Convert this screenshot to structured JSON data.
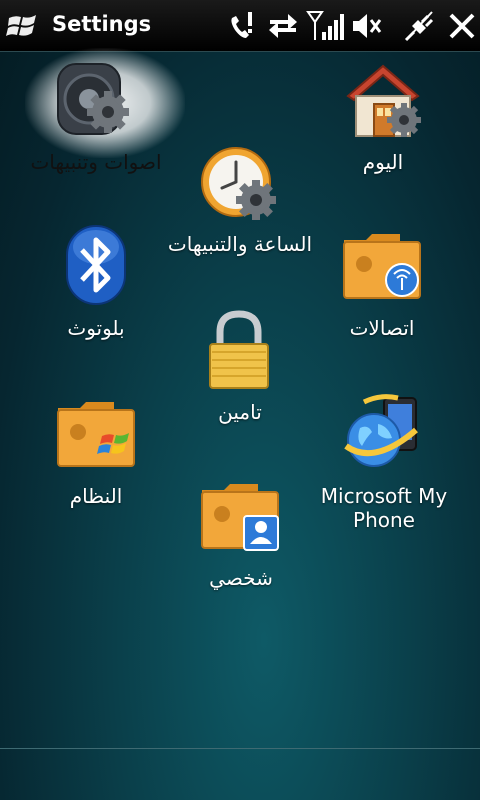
{
  "header": {
    "title": "Settings"
  },
  "status_icons": [
    "phone-missed-icon",
    "sync-icon",
    "signal-icon",
    "speaker-mute-icon",
    "connectivity-icon",
    "close-icon"
  ],
  "items": [
    {
      "id": "sounds",
      "label": "اصوات وتنبيهات",
      "icon": "speaker-gear-icon",
      "selected": true
    },
    {
      "id": "today",
      "label": "اليوم",
      "icon": "home-gear-icon"
    },
    {
      "id": "clock",
      "label": "الساعة والتنبيهات",
      "icon": "clock-gear-icon"
    },
    {
      "id": "bluetooth",
      "label": "بلوتوث",
      "icon": "bluetooth-icon"
    },
    {
      "id": "connections",
      "label": "اتصالات",
      "icon": "connections-folder-icon"
    },
    {
      "id": "security",
      "label": "تامين",
      "icon": "lock-icon"
    },
    {
      "id": "system",
      "label": "النظام",
      "icon": "windows-folder-icon"
    },
    {
      "id": "myphone",
      "label": "Microsoft My Phone",
      "label_line1": "Microsoft My",
      "label_line2": "Phone",
      "icon": "globe-phone-icon"
    },
    {
      "id": "personal",
      "label": "شخصي",
      "icon": "contact-folder-icon"
    }
  ],
  "colors": {
    "folder": "#f2a73a",
    "background": "#0a3f4a",
    "accent": "#3b7ddd"
  }
}
